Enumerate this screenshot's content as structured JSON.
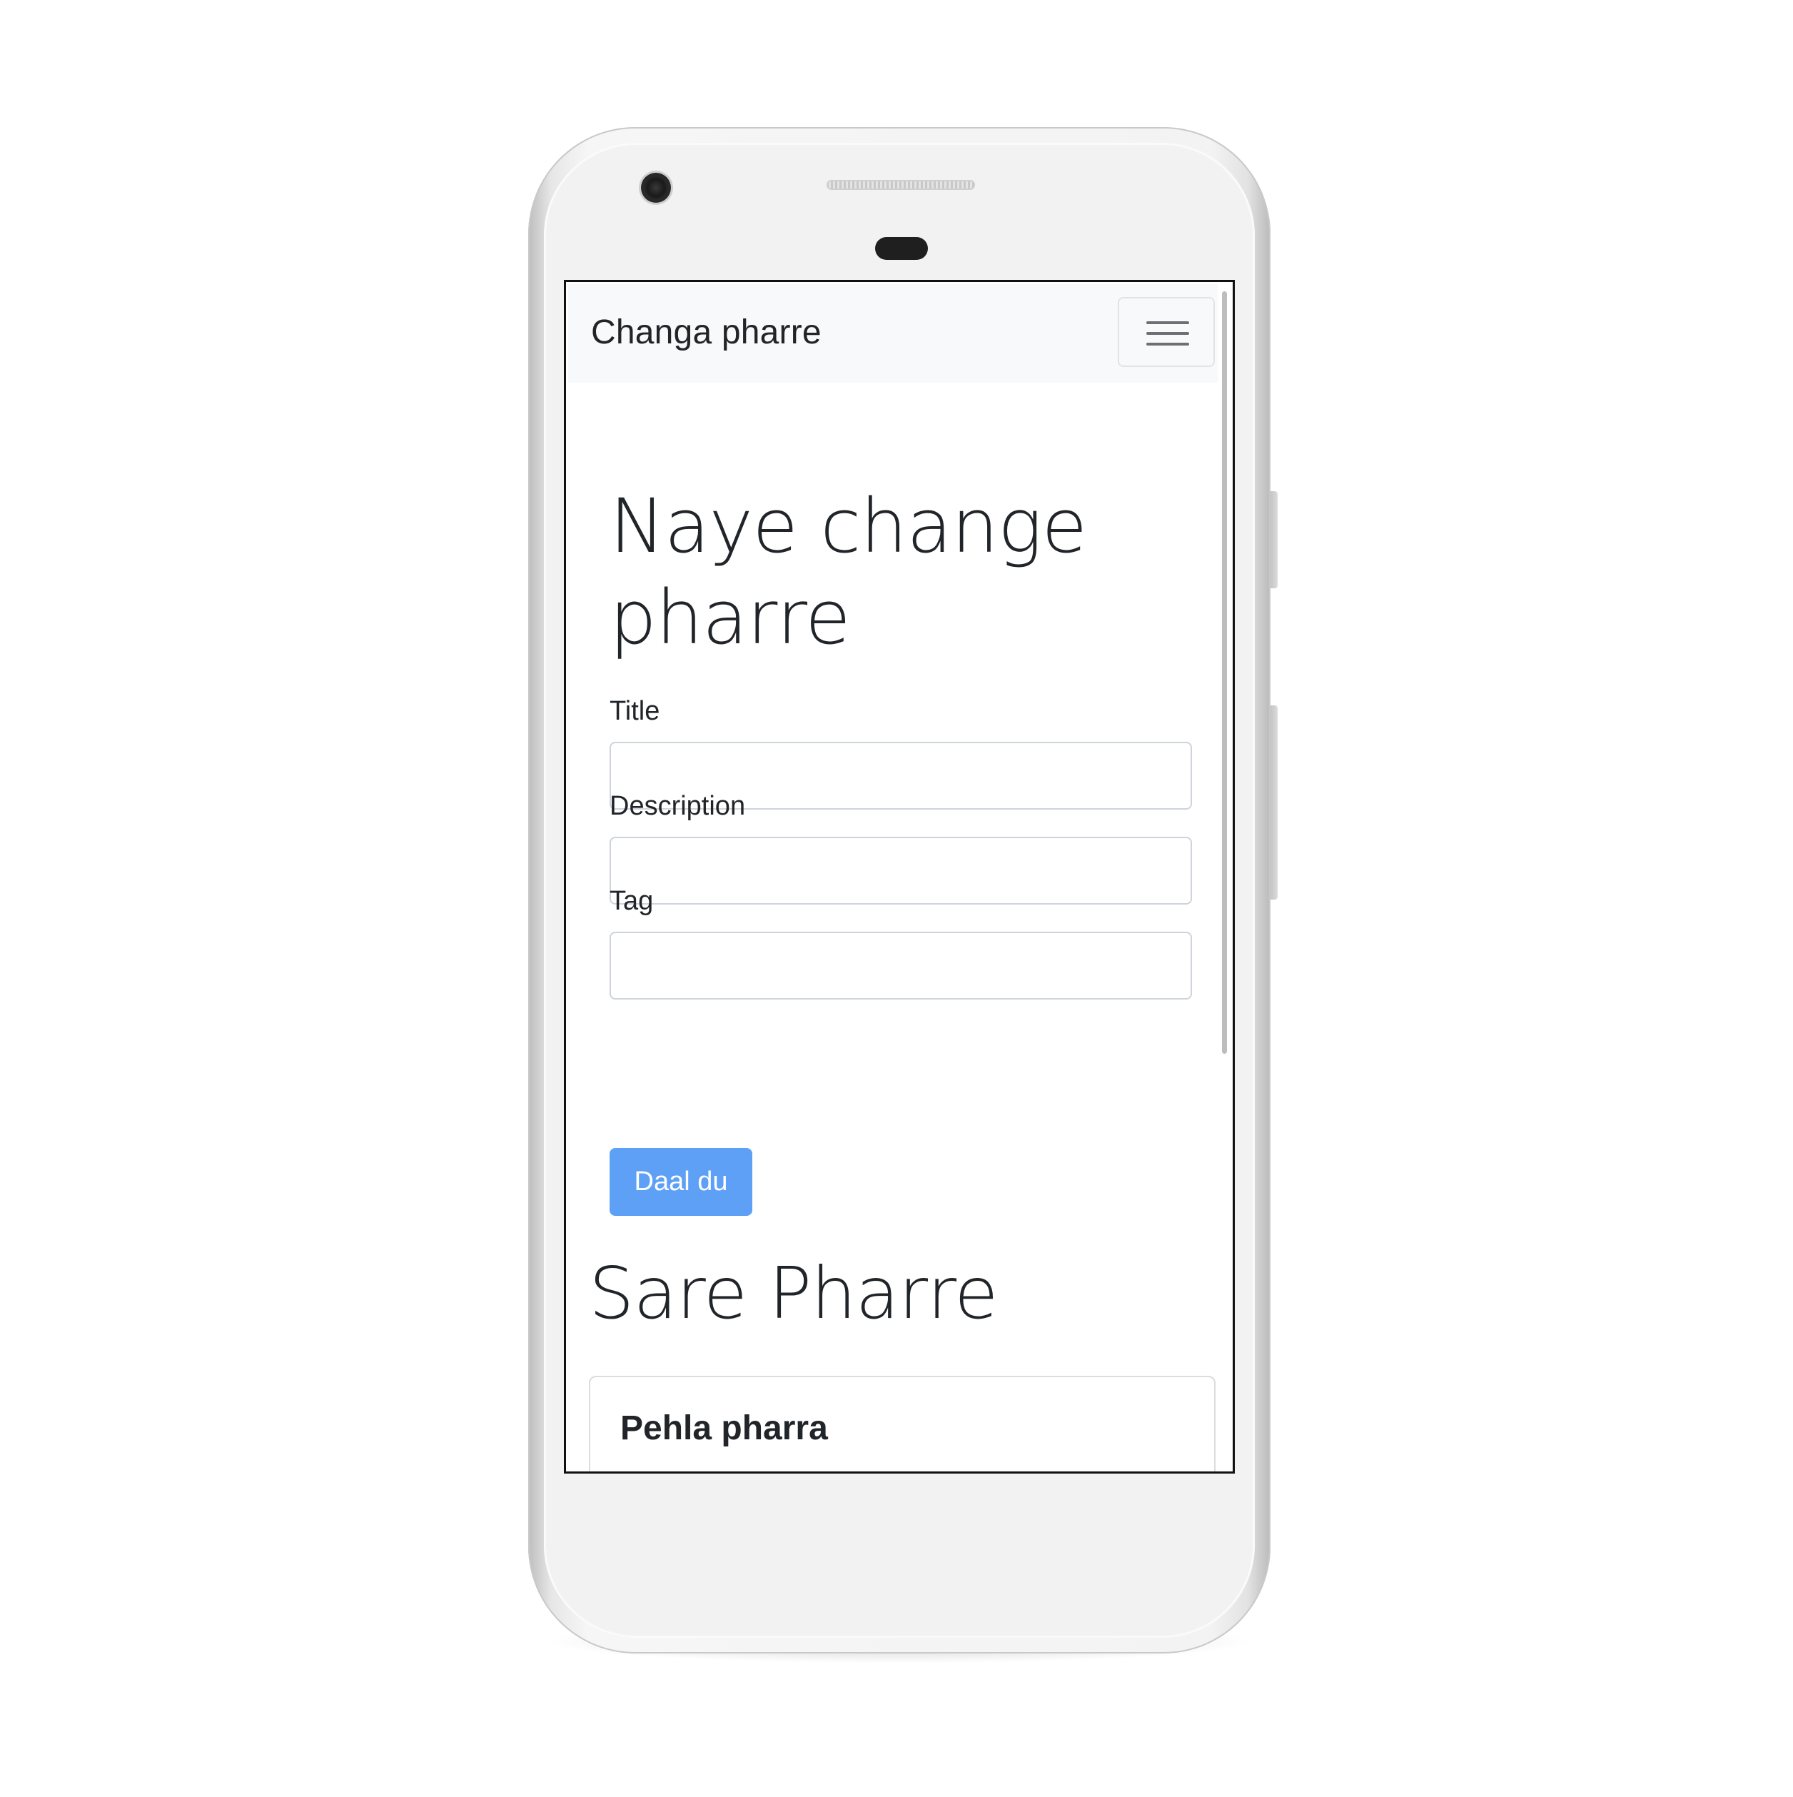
{
  "navbar": {
    "brand": "Changa pharre",
    "toggler_icon": "hamburger-menu-icon"
  },
  "form": {
    "heading": "Naye change pharre",
    "fields": [
      {
        "label": "Title",
        "value": "",
        "placeholder": ""
      },
      {
        "label": "Description",
        "value": "",
        "placeholder": ""
      },
      {
        "label": "Tag",
        "value": "",
        "placeholder": ""
      }
    ],
    "submit_label": "Daal du"
  },
  "list": {
    "heading": "Sare Pharre",
    "cards": [
      {
        "title": "Pehla pharra"
      }
    ]
  },
  "colors": {
    "navbar_bg": "#f8f9fa",
    "button_bg": "#5ea0f6",
    "text": "#212529",
    "input_border": "#ced4da"
  }
}
